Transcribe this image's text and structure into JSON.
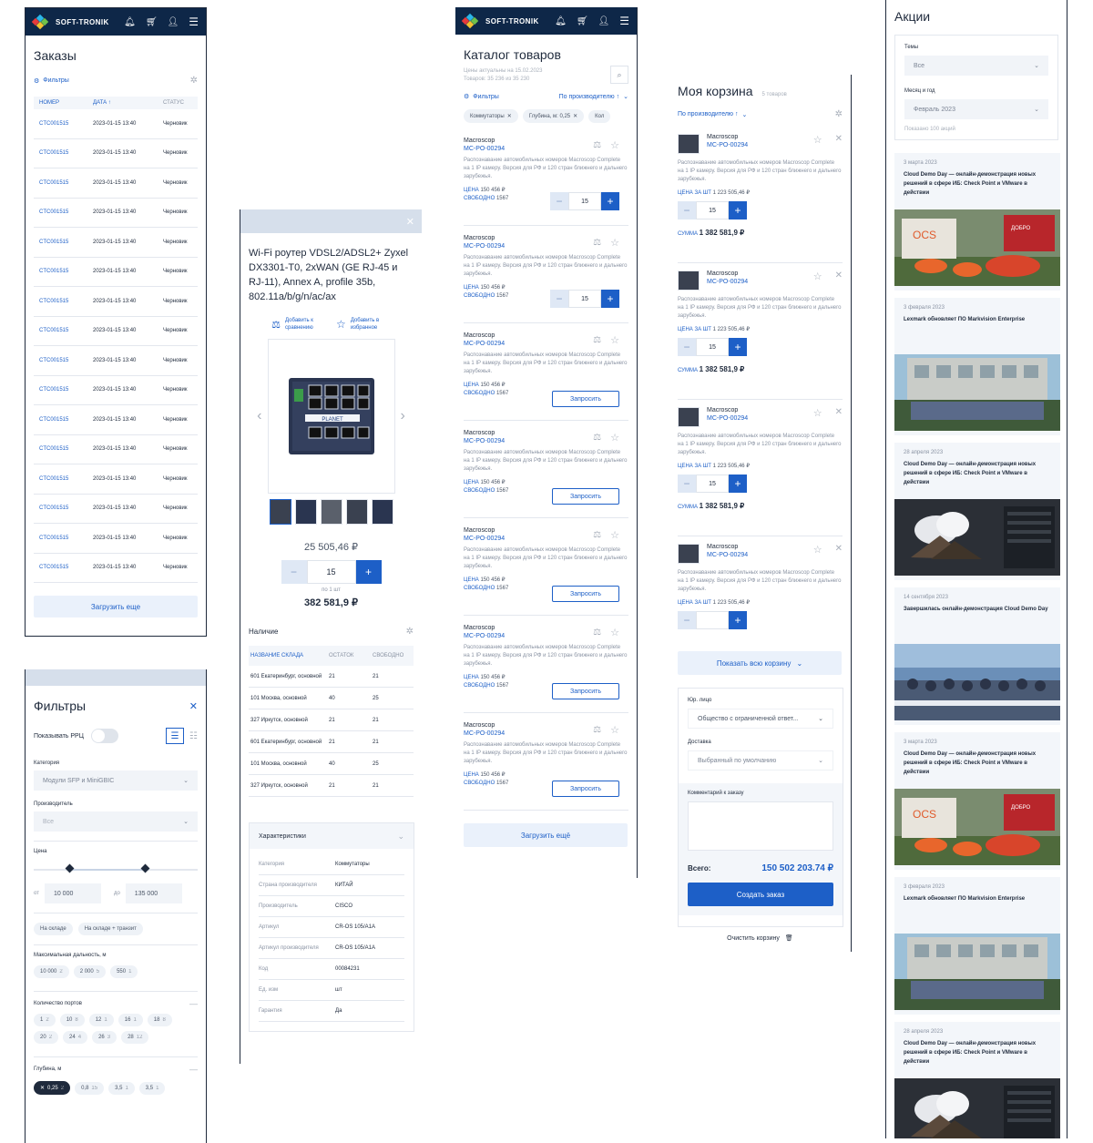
{
  "brand": {
    "name": "SOFT-TRONIK",
    "colors": {
      "header": "#0e2748",
      "accent": "#1d5fc7"
    }
  },
  "header_icons": [
    "bell-icon",
    "cart-icon",
    "user-icon",
    "menu-icon"
  ],
  "orders": {
    "title": "Заказы",
    "filters_label": "Фильтры",
    "columns": [
      "НОМЕР",
      "ДАТА ↑",
      "СТАТУС"
    ],
    "rows": [
      {
        "num": "CTC001515",
        "date": "2023-01-15 13:40",
        "status": "Черновик"
      },
      {
        "num": "CTC001515",
        "date": "2023-01-15 13:40",
        "status": "Черновик"
      },
      {
        "num": "CTC001515",
        "date": "2023-01-15 13:40",
        "status": "Черновик"
      },
      {
        "num": "CTC001515",
        "date": "2023-01-15 13:40",
        "status": "Черновик"
      },
      {
        "num": "CTC001515",
        "date": "2023-01-15 13:40",
        "status": "Черновик"
      },
      {
        "num": "CTC001515",
        "date": "2023-01-15 13:40",
        "status": "Черновик"
      },
      {
        "num": "CTC001515",
        "date": "2023-01-15 13:40",
        "status": "Черновик"
      },
      {
        "num": "CTC001515",
        "date": "2023-01-15 13:40",
        "status": "Черновик"
      },
      {
        "num": "CTC001515",
        "date": "2023-01-15 13:40",
        "status": "Черновик"
      },
      {
        "num": "CTC001515",
        "date": "2023-01-15 13:40",
        "status": "Черновик"
      },
      {
        "num": "CTC001515",
        "date": "2023-01-15 13:40",
        "status": "Черновик"
      },
      {
        "num": "CTC001515",
        "date": "2023-01-15 13:40",
        "status": "Черновик"
      },
      {
        "num": "CTC001515",
        "date": "2023-01-15 13:40",
        "status": "Черновик"
      },
      {
        "num": "CTC001515",
        "date": "2023-01-15 13:40",
        "status": "Черновик"
      },
      {
        "num": "CTC001515",
        "date": "2023-01-15 13:40",
        "status": "Черновик"
      },
      {
        "num": "CTC001515",
        "date": "2023-01-15 13:40",
        "status": "Черновик"
      }
    ],
    "load_more": "Загрузить еще"
  },
  "filters": {
    "title": "Фильтры",
    "show_rrp": "Показывать РРЦ",
    "category_label": "Категория",
    "category_value": "Модули SFP и MiniGBIC",
    "manufacturer_label": "Производитель",
    "manufacturer_value": "Все",
    "price_label": "Цена",
    "from_label": "от",
    "from_value": "10 000",
    "to_label": "до",
    "to_value": "135 000",
    "stock_chips": [
      "На складе",
      "На складе + транзит"
    ],
    "distance_label": "Максимальная дальность, м",
    "distance_chips": [
      {
        "v": "10 000",
        "c": "2"
      },
      {
        "v": "2 000",
        "c": "5"
      },
      {
        "v": "550",
        "c": "1"
      }
    ],
    "ports_label": "Количество портов",
    "ports_chips": [
      {
        "v": "1",
        "c": "2"
      },
      {
        "v": "10",
        "c": "8"
      },
      {
        "v": "12",
        "c": "1"
      },
      {
        "v": "16",
        "c": "1"
      },
      {
        "v": "18",
        "c": "8"
      },
      {
        "v": "20",
        "c": "2"
      },
      {
        "v": "24",
        "c": "4"
      },
      {
        "v": "26",
        "c": "3"
      },
      {
        "v": "28",
        "c": "12"
      }
    ],
    "depth_label": "Глубина, м",
    "depth_chips": [
      {
        "v": "0,25",
        "c": "2"
      },
      {
        "v": "0,8",
        "c": "15"
      },
      {
        "v": "3,5",
        "c": "1"
      },
      {
        "v": "3,5",
        "c": "1"
      }
    ]
  },
  "product": {
    "title": "Wi-Fi роутер VDSL2/ADSL2+ Zyxel DX3301-T0, 2xWAN (GE RJ-45 и RJ-11), Annex A, profile 35b, 802.11a/b/g/n/ac/ax",
    "compare_label": "Добавить к сравнению",
    "favorite_label": "Добавить в избранное",
    "price": "25 505,46 ₽",
    "qty": "15",
    "per_unit": "по 1 шт",
    "total": "382 581,9 ₽",
    "availability_title": "Наличие",
    "avail_columns": [
      "НАЗВАНИЕ СКЛАДА",
      "ОСТАТОК",
      "СВОБОДНО"
    ],
    "avail_rows": [
      {
        "name": "601 Екатеринбург, основной",
        "rest": "21",
        "free": "21"
      },
      {
        "name": "101 Москва, основной",
        "rest": "40",
        "free": "25"
      },
      {
        "name": "327 Иркутск, основной",
        "rest": "21",
        "free": "21"
      },
      {
        "name": "601 Екатеринбург, основной",
        "rest": "21",
        "free": "21"
      },
      {
        "name": "101 Москва, основной",
        "rest": "40",
        "free": "25"
      },
      {
        "name": "327 Иркутск, основной",
        "rest": "21",
        "free": "21"
      }
    ],
    "specs_title": "Характеристики",
    "specs": [
      {
        "k": "Категория",
        "v": "Коммутаторы"
      },
      {
        "k": "Страна производителя",
        "v": "КИТАЙ"
      },
      {
        "k": "Производитель",
        "v": "CISCO"
      },
      {
        "k": "Артикул",
        "v": "CR-OS 105/A1A"
      },
      {
        "k": "Артикул производителя",
        "v": "CR-OS 105/A1A"
      },
      {
        "k": "Код",
        "v": "00084231"
      },
      {
        "k": "Ед. изм",
        "v": "шт"
      },
      {
        "k": "Гарантия",
        "v": "Да"
      }
    ]
  },
  "catalog": {
    "title": "Каталог товаров",
    "subtitle1": "Цены актуальны на 15.02.2023",
    "subtitle2": "Товаров: 35 236 из 35 230",
    "filters_label": "Фильтры",
    "sort_label": "По производителю ↑",
    "chips": [
      "Коммутаторы",
      "Глубина, м: 0,25",
      "Кол"
    ],
    "items": [
      {
        "vendor": "Macroscop",
        "code": "MC-PO-00294",
        "desc": "Распознавание автомобильных номеров Macroscop Complete на 1 IP камеру. Версия для РФ и 120 стран ближнего и дальнего зарубежья.",
        "price_label": "ЦЕНА",
        "price": "150 456 ₽",
        "free_label": "СВОБОДНО",
        "free": "1567",
        "qty": "15",
        "mode": "stepper"
      },
      {
        "vendor": "Macroscop",
        "code": "MC-PO-00294",
        "desc": "Распознавание автомобильных номеров Macroscop Complete на 1 IP камеру. Версия для РФ и 120 стран ближнего и дальнего зарубежья.",
        "price_label": "ЦЕНА",
        "price": "150 456 ₽",
        "free_label": "СВОБОДНО",
        "free": "1567",
        "qty": "15",
        "mode": "stepper"
      },
      {
        "vendor": "Macroscop",
        "code": "MC-PO-00294",
        "desc": "Распознавание автомобильных номеров Macroscop Complete на 1 IP камеру. Версия для РФ и 120 стран ближнего и дальнего зарубежья.",
        "price_label": "ЦЕНА",
        "price": "150 456 ₽",
        "free_label": "СВОБОДНО",
        "free": "1567",
        "qty": "",
        "mode": "request"
      },
      {
        "vendor": "Macroscop",
        "code": "MC-PO-00294",
        "desc": "Распознавание автомобильных номеров Macroscop Complete на 1 IP камеру. Версия для РФ и 120 стран ближнего и дальнего зарубежья.",
        "price_label": "ЦЕНА",
        "price": "150 456 ₽",
        "free_label": "СВОБОДНО",
        "free": "1567",
        "qty": "",
        "mode": "request"
      },
      {
        "vendor": "Macroscop",
        "code": "MC-PO-00294",
        "desc": "Распознавание автомобильных номеров Macroscop Complete на 1 IP камеру. Версия для РФ и 120 стран ближнего и дальнего зарубежья.",
        "price_label": "ЦЕНА",
        "price": "150 456 ₽",
        "free_label": "СВОБОДНО",
        "free": "1567",
        "qty": "",
        "mode": "request"
      },
      {
        "vendor": "Macroscop",
        "code": "MC-PO-00294",
        "desc": "Распознавание автомобильных номеров Macroscop Complete на 1 IP камеру. Версия для РФ и 120 стран ближнего и дальнего зарубежья.",
        "price_label": "ЦЕНА",
        "price": "150 456 ₽",
        "free_label": "СВОБОДНО",
        "free": "1567",
        "qty": "",
        "mode": "request"
      },
      {
        "vendor": "Macroscop",
        "code": "MC-PO-00294",
        "desc": "Распознавание автомобильных номеров Macroscop Complete на 1 IP камеру. Версия для РФ и 120 стран ближнего и дальнего зарубежья.",
        "price_label": "ЦЕНА",
        "price": "150 456 ₽",
        "free_label": "СВОБОДНО",
        "free": "1567",
        "qty": "",
        "mode": "request"
      }
    ],
    "request_label": "Запросить",
    "load_more": "Загрузить ещё"
  },
  "cart": {
    "title": "Моя корзина",
    "count": "5 товаров",
    "sort_label": "По производителю ↑",
    "items": [
      {
        "vendor": "Macroscop",
        "code": "MC-PO-00294",
        "desc": "Распознавание автомобильных номеров Macroscop Complete на 1 IP камеру. Версия для РФ и 120 стран ближнего и дальнего зарубежья.",
        "price_label": "ЦЕНА ЗА ШТ",
        "price": "1 223 505,46 ₽",
        "qty": "15",
        "sum_label": "СУММА",
        "sum": "1 382 581,9 ₽"
      },
      {
        "vendor": "Macroscop",
        "code": "MC-PO-00294",
        "desc": "Распознавание автомобильных номеров Macroscop Complete на 1 IP камеру. Версия для РФ и 120 стран ближнего и дальнего зарубежья.",
        "price_label": "ЦЕНА ЗА ШТ",
        "price": "1 223 505,46 ₽",
        "qty": "15",
        "sum_label": "СУММА",
        "sum": "1 382 581,9 ₽"
      },
      {
        "vendor": "Macroscop",
        "code": "MC-PO-00294",
        "desc": "Распознавание автомобильных номеров Macroscop Complete на 1 IP камеру. Версия для РФ и 120 стран ближнего и дальнего зарубежья.",
        "price_label": "ЦЕНА ЗА ШТ",
        "price": "1 223 505,46 ₽",
        "qty": "15",
        "sum_label": "СУММА",
        "sum": "1 382 581,9 ₽"
      },
      {
        "vendor": "Macroscop",
        "code": "MC-PO-00294",
        "desc": "Распознавание автомобильных номеров Macroscop Complete на 1 IP камеру. Версия для РФ и 120 стран ближнего и дальнего зарубежья.",
        "price_label": "ЦЕНА ЗА ШТ",
        "price": "1 223 505,46 ₽",
        "qty": "",
        "sum_label": "",
        "sum": ""
      }
    ],
    "show_all": "Показать всю корзину",
    "legal_label": "Юр. лицо",
    "legal_value": "Общество с ограниченной ответ...",
    "delivery_label": "Доставка",
    "delivery_value": "Выбранный по умолчанию",
    "comment_label": "Комментарий к заказу",
    "total_label": "Всего:",
    "total_value": "150 502 203.74 ₽",
    "create_order": "Создать заказ",
    "clear_cart": "Очистить корзину"
  },
  "promo": {
    "title": "Акции",
    "theme_label": "Темы",
    "theme_value": "Все",
    "month_label": "Месяц и год",
    "month_value": "Февраль 2023",
    "found": "Показано 100 акций",
    "cards": [
      {
        "date": "3 марта 2023",
        "title": "Cloud Demo Day — онлайн-демонстрация новых решений в сфере ИБ: Check Point и VMware в действии",
        "img": "booth"
      },
      {
        "date": "3 февраля 2023",
        "title": "Lexmark обновляет ПО Markvision Enterprise",
        "img": "group"
      },
      {
        "date": "28 апреля 2023",
        "title": "Cloud Demo Day — онлайн-демонстрация новых решений в сфере ИБ: Check Point и VMware в действии",
        "img": "cloud"
      },
      {
        "date": "14 сентября 2023",
        "title": "Завершилась онлайн-демонстрация Cloud Demo Day",
        "img": "hall"
      },
      {
        "date": "3 марта 2023",
        "title": "Cloud Demo Day — онлайн-демонстрация новых решений в сфере ИБ: Check Point и VMware в действии",
        "img": "booth"
      },
      {
        "date": "3 февраля 2023",
        "title": "Lexmark обновляет ПО Markvision Enterprise",
        "img": "group"
      },
      {
        "date": "28 апреля 2023",
        "title": "Cloud Demo Day — онлайн-демонстрация новых решений в сфере ИБ: Check Point и VMware в действии",
        "img": "cloud"
      }
    ]
  }
}
